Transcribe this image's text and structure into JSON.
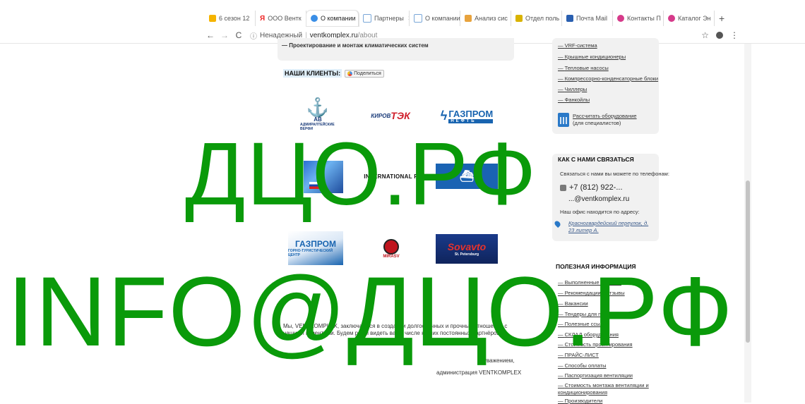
{
  "browser": {
    "tabs": [
      {
        "label": "6 сезон 12",
        "color": "#f5b400"
      },
      {
        "label": "ООО Вентк",
        "color": "#ffffff",
        "glyph": "Я"
      },
      {
        "label": "О компании",
        "color": "#3a8ee6",
        "active": true
      },
      {
        "label": "Партнеры",
        "color": "#7aa7d8"
      },
      {
        "label": "О компании",
        "color": "#7aa7d8"
      },
      {
        "label": "Анализ сис",
        "color": "#e8a33d"
      },
      {
        "label": "Отдел поль",
        "color": "#d9b300"
      },
      {
        "label": "Почта Mail",
        "color": "#2a5fb0"
      },
      {
        "label": "Контакты П",
        "color": "#d63a8a"
      },
      {
        "label": "Каталог Эн",
        "color": "#d63a8a"
      }
    ],
    "new_tab": "+",
    "back": "←",
    "forward": "→",
    "reload": "C",
    "security": "Ненадежный",
    "url_host": "ventkomplex.ru",
    "url_path": "/about",
    "star": "☆",
    "account": "👤",
    "menu": "⋮"
  },
  "content": {
    "service_line": "— Проектирование и монтаж климатических систем",
    "clients_title": "НАШИ КЛИЕНТЫ:",
    "share_label": "Поделиться",
    "logos": {
      "admiralty_caption": "АДМИРАЛТЕЙСКИЕ ВЕРФИ",
      "admiralty_mark": "АВ",
      "kirov_a": "КИРОВ",
      "kirov_b": "ТЭК",
      "gpn1_main": "ГАЗПРОМ",
      "gpn1_sub": "НЕФТЬ",
      "ip": "INTERNATIONAL PAPER",
      "gpn2_main": "ГАЗПРОМ",
      "gpn2_sub": "ГОРНО-ТУРИСТИЧЕСКИЙ ЦЕНТР",
      "mirasv": "MIRASV",
      "sovavto": "Sovavto",
      "sovavto_sub": "St. Petersburg"
    },
    "paragraph": "Мы, VENTKOMPLEX, заключаемся в создании долгосрочных и прочных отношений с нашими клиентами. Будем рады видеть вас в числе наших постоянных партнёров!",
    "regards": "С уважением,",
    "signature": "администрация VENTKOMPLEX"
  },
  "sidebar": {
    "equipment_links": [
      "VRF-система",
      "Крышные кондиционеры",
      "Тепловые насосы",
      "Компрессорно-конденсаторные блоки",
      "Чиллеры",
      "Фанкойлы"
    ],
    "calc_link": "Рассчитать оборудование",
    "calc_note": "(для специалистов)",
    "contact_title": "КАК С НАМИ СВЯЗАТЬСЯ",
    "contact_intro": "Связаться с нами вы можете по телефонам:",
    "phone": "+7 (812) 922-...",
    "email": "...@ventkomplex.ru",
    "address_intro": "Наш офис находится по адресу:",
    "address": "Красногвардейский переулок, д. 23 литер А.",
    "useful_title": "ПОЛЕЗНАЯ ИНФОРМАЦИЯ",
    "useful_links": [
      "Выполненные объекты",
      "Рекомендации и отзывы",
      "Вакансии",
      "Тендеры для подрядчиков",
      "Полезные ссылки",
      "СКЛАД оборудования",
      "Стоимость проектирования",
      "ПРАЙС-ЛИСТ",
      "Способы оплаты",
      "Паспортизация вентиляции",
      "Стоимость монтажа вентиляции и кондиционирования",
      "Производители"
    ]
  },
  "watermark": {
    "line1": "ДЦО.РФ",
    "line2": "INFO@ДЦО.РФ",
    "color": "#0a9a0a"
  }
}
